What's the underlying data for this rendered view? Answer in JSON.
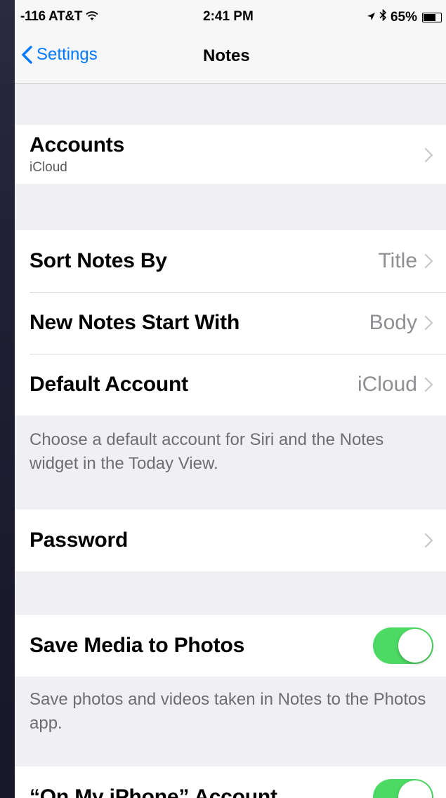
{
  "status_bar": {
    "carrier": "-116 AT&T",
    "time": "2:41 PM",
    "battery": "65%",
    "battery_level": 0.65,
    "icons": [
      "wifi-icon",
      "location-arrow-icon",
      "bluetooth-icon",
      "battery-icon"
    ]
  },
  "nav": {
    "back_label": "Settings",
    "title": "Notes"
  },
  "accounts": {
    "label": "Accounts",
    "subtitle": "iCloud"
  },
  "sort_group": {
    "items": [
      {
        "label": "Sort Notes By",
        "value": "Title"
      },
      {
        "label": "New Notes Start With",
        "value": "Body"
      },
      {
        "label": "Default Account",
        "value": "iCloud"
      }
    ],
    "footer": "Choose a default account for Siri and the Notes widget in the Today View."
  },
  "password": {
    "label": "Password"
  },
  "media": {
    "label": "Save Media to Photos",
    "enabled": true,
    "footer": "Save photos and videos taken in Notes to the Photos app."
  },
  "on_my_iphone": {
    "label": "“On My iPhone” Account",
    "enabled": true
  },
  "colors": {
    "tint": "#007aff",
    "toggle_on": "#4cd964",
    "background": "#efeff4"
  }
}
